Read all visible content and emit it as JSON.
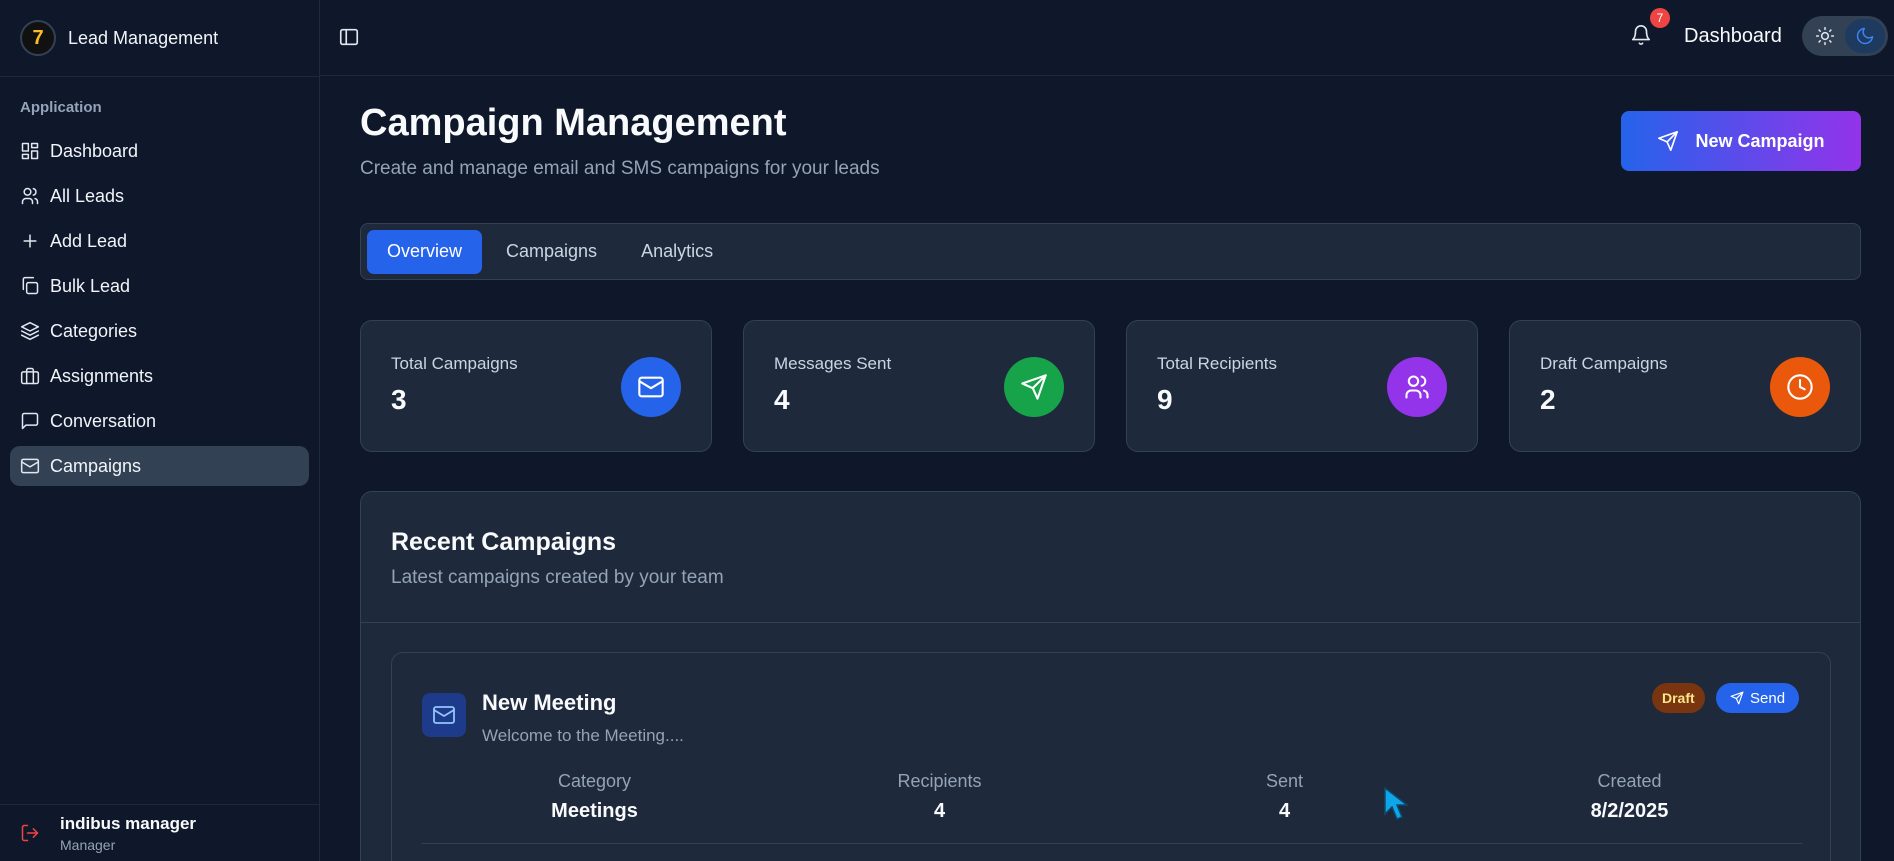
{
  "brand": {
    "name": "Lead Management",
    "logo_text": "7"
  },
  "sidebar": {
    "section_label": "Application",
    "items": [
      {
        "label": "Dashboard",
        "icon": "dashboard-icon"
      },
      {
        "label": "All Leads",
        "icon": "users-icon"
      },
      {
        "label": "Add Lead",
        "icon": "plus-icon"
      },
      {
        "label": "Bulk Lead",
        "icon": "copy-icon"
      },
      {
        "label": "Categories",
        "icon": "layers-icon"
      },
      {
        "label": "Assignments",
        "icon": "briefcase-icon"
      },
      {
        "label": "Conversation",
        "icon": "message-icon"
      },
      {
        "label": "Campaigns",
        "icon": "mail-icon",
        "active": true
      }
    ],
    "user": {
      "name": "indibus manager",
      "role": "Manager"
    }
  },
  "topbar": {
    "notification_count": "7",
    "title": "Dashboard"
  },
  "page": {
    "title": "Campaign Management",
    "subtitle": "Create and manage email and SMS campaigns for your leads",
    "new_button": "New Campaign"
  },
  "tabs": [
    {
      "label": "Overview",
      "active": true
    },
    {
      "label": "Campaigns"
    },
    {
      "label": "Analytics"
    }
  ],
  "stats": [
    {
      "label": "Total Campaigns",
      "value": "3",
      "color": "#2563eb",
      "icon": "mail-icon"
    },
    {
      "label": "Messages Sent",
      "value": "4",
      "color": "#16a34a",
      "icon": "send-icon"
    },
    {
      "label": "Total Recipients",
      "value": "9",
      "color": "#9333ea",
      "icon": "users-icon"
    },
    {
      "label": "Draft Campaigns",
      "value": "2",
      "color": "#ea580c",
      "icon": "clock-icon"
    }
  ],
  "recent": {
    "title": "Recent Campaigns",
    "subtitle": "Latest campaigns created by your team",
    "campaigns": [
      {
        "name": "New Meeting",
        "description": "Welcome to the Meeting....",
        "status": "Draft",
        "action": "Send",
        "metrics": [
          {
            "label": "Category",
            "value": "Meetings"
          },
          {
            "label": "Recipients",
            "value": "4"
          },
          {
            "label": "Sent",
            "value": "4"
          },
          {
            "label": "Created",
            "value": "8/2/2025"
          }
        ]
      }
    ]
  }
}
